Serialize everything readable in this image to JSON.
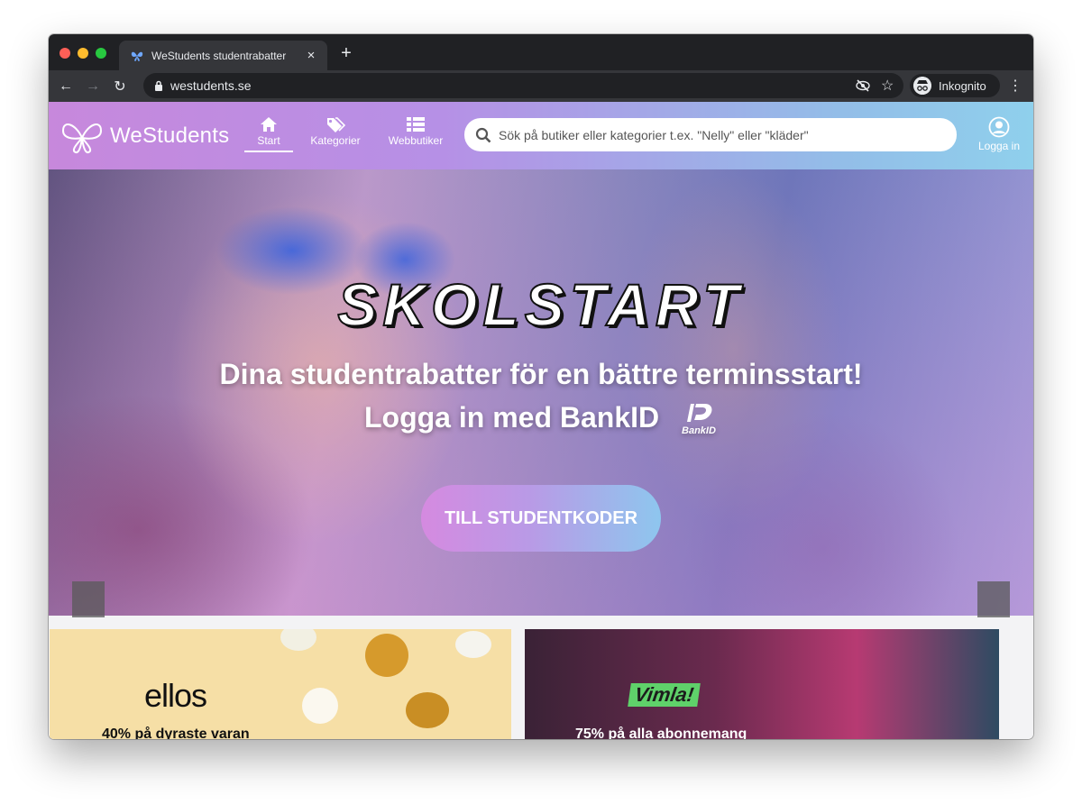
{
  "browser": {
    "tab_title": "WeStudents studentrabatter",
    "tab_close": "×",
    "new_tab": "+",
    "url": "westudents.se",
    "profile_label": "Inkognito",
    "menu": "⋮"
  },
  "site": {
    "logo_text": "WeStudents",
    "nav": [
      {
        "label": "Start",
        "icon": "home-icon",
        "active": true
      },
      {
        "label": "Kategorier",
        "icon": "tags-icon",
        "active": false
      },
      {
        "label": "Webbutiker",
        "icon": "list-icon",
        "active": false
      }
    ],
    "search": {
      "placeholder": "Sök på butiker eller kategorier t.ex. \"Nelly\" eller \"kläder\""
    },
    "login_label": "Logga in",
    "accent_colors": [
      "#c788dc",
      "#8fd0ec"
    ]
  },
  "hero": {
    "headline": "SKOLSTART",
    "subtitle": "Dina studentrabatter för en bättre terminsstart!",
    "login_text": "Logga in med BankID",
    "bankid_label": "BankID",
    "cta_label": "TILL STUDENTKODER"
  },
  "cards": [
    {
      "brand": "ellos",
      "text": "40% på dyraste varan"
    },
    {
      "brand": "Vimla!",
      "text": "75% på alla abonnemang"
    }
  ]
}
